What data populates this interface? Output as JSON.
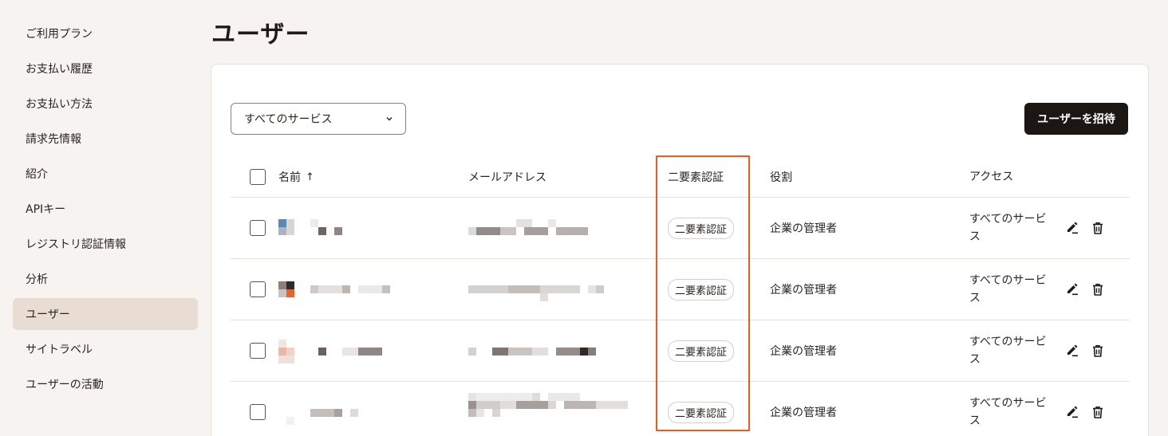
{
  "sidebar": {
    "items": [
      {
        "label": "ご利用プラン"
      },
      {
        "label": "お支払い履歴"
      },
      {
        "label": "お支払い方法"
      },
      {
        "label": "請求先情報"
      },
      {
        "label": "紹介"
      },
      {
        "label": "APIキー"
      },
      {
        "label": "レジストリ認証情報"
      },
      {
        "label": "分析"
      },
      {
        "label": "ユーザー",
        "active": true
      },
      {
        "label": "サイトラベル"
      },
      {
        "label": "ユーザーの活動"
      }
    ]
  },
  "page": {
    "title": "ユーザー"
  },
  "toolbar": {
    "filter_value": "すべてのサービス",
    "invite_label": "ユーザーを招待"
  },
  "table": {
    "headers": {
      "name": "名前",
      "sort_indicator": "↑",
      "email": "メールアドレス",
      "two_factor": "二要素認証",
      "role": "役割",
      "access": "アクセス"
    },
    "rows": [
      {
        "two_factor": "二要素認証",
        "role": "企業の管理者",
        "access": "すべてのサービス"
      },
      {
        "two_factor": "二要素認証",
        "role": "企業の管理者",
        "access": "すべてのサービス"
      },
      {
        "two_factor": "二要素認証",
        "role": "企業の管理者",
        "access": "すべてのサービス"
      },
      {
        "two_factor": "二要素認証",
        "role": "企業の管理者",
        "access": "すべてのサービス"
      }
    ]
  },
  "colors": {
    "accent_highlight": "#f05a1e",
    "primary_button": "#1c1714",
    "active_nav": "#e8dcd3"
  }
}
